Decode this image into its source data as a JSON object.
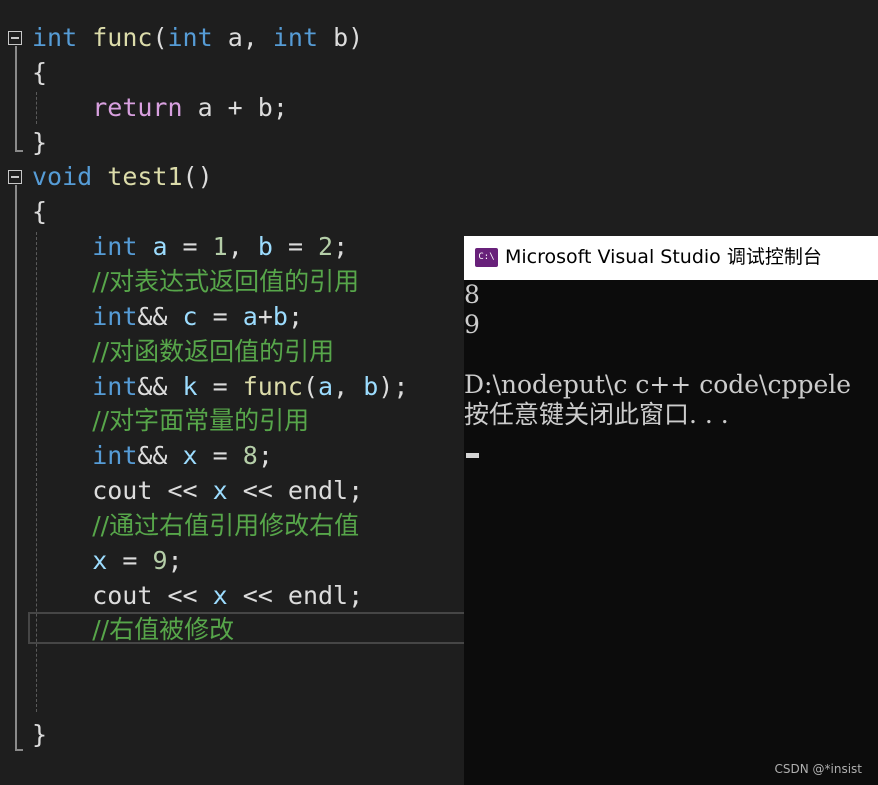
{
  "editor": {
    "lines": [
      [
        {
          "t": "int",
          "c": "kw"
        },
        {
          "t": " "
        },
        {
          "t": "func",
          "c": "fn"
        },
        {
          "t": "("
        },
        {
          "t": "int",
          "c": "kw"
        },
        {
          "t": " a, "
        },
        {
          "t": "int",
          "c": "kw"
        },
        {
          "t": " b)"
        }
      ],
      [
        {
          "t": "{"
        }
      ],
      [
        {
          "t": "    "
        },
        {
          "t": "return",
          "c": "ctrl"
        },
        {
          "t": " a + b;"
        }
      ],
      [
        {
          "t": "}"
        }
      ],
      [
        {
          "t": "void",
          "c": "kw"
        },
        {
          "t": " "
        },
        {
          "t": "test1",
          "c": "fn"
        },
        {
          "t": "()"
        }
      ],
      [
        {
          "t": "{"
        }
      ],
      [
        {
          "t": "    "
        },
        {
          "t": "int",
          "c": "kw"
        },
        {
          "t": " "
        },
        {
          "t": "a",
          "c": "var"
        },
        {
          "t": " = "
        },
        {
          "t": "1",
          "c": "num"
        },
        {
          "t": ", "
        },
        {
          "t": "b",
          "c": "var"
        },
        {
          "t": " = "
        },
        {
          "t": "2",
          "c": "num"
        },
        {
          "t": ";"
        }
      ],
      [
        {
          "t": "    "
        },
        {
          "t": "//对表达式返回值的引用",
          "c": "cm"
        }
      ],
      [
        {
          "t": "    "
        },
        {
          "t": "int",
          "c": "kw"
        },
        {
          "t": "&& "
        },
        {
          "t": "c",
          "c": "var"
        },
        {
          "t": " = "
        },
        {
          "t": "a",
          "c": "var"
        },
        {
          "t": "+"
        },
        {
          "t": "b",
          "c": "var"
        },
        {
          "t": ";"
        }
      ],
      [
        {
          "t": "    "
        },
        {
          "t": "//对函数返回值的引用",
          "c": "cm"
        }
      ],
      [
        {
          "t": "    "
        },
        {
          "t": "int",
          "c": "kw"
        },
        {
          "t": "&& "
        },
        {
          "t": "k",
          "c": "var"
        },
        {
          "t": " = "
        },
        {
          "t": "func",
          "c": "fn"
        },
        {
          "t": "("
        },
        {
          "t": "a",
          "c": "var"
        },
        {
          "t": ", "
        },
        {
          "t": "b",
          "c": "var"
        },
        {
          "t": ");"
        }
      ],
      [
        {
          "t": "    "
        },
        {
          "t": "//对字面常量的引用",
          "c": "cm"
        }
      ],
      [
        {
          "t": "    "
        },
        {
          "t": "int",
          "c": "kw"
        },
        {
          "t": "&& "
        },
        {
          "t": "x",
          "c": "var"
        },
        {
          "t": " = "
        },
        {
          "t": "8",
          "c": "num"
        },
        {
          "t": ";"
        }
      ],
      [
        {
          "t": "    cout << "
        },
        {
          "t": "x",
          "c": "var"
        },
        {
          "t": " << endl;"
        }
      ],
      [
        {
          "t": "    "
        },
        {
          "t": "//通过右值引用修改右值",
          "c": "cm"
        }
      ],
      [
        {
          "t": "    "
        },
        {
          "t": "x",
          "c": "var"
        },
        {
          "t": " = "
        },
        {
          "t": "9",
          "c": "num"
        },
        {
          "t": ";"
        }
      ],
      [
        {
          "t": "    cout << "
        },
        {
          "t": "x",
          "c": "var"
        },
        {
          "t": " << endl;"
        }
      ],
      [
        {
          "t": "    "
        },
        {
          "t": "//右值被修改",
          "c": "cm"
        }
      ],
      [],
      [],
      [
        {
          "t": "}"
        }
      ]
    ]
  },
  "console": {
    "title": "Microsoft Visual Studio 调试控制台",
    "icon": "vs-console-icon",
    "icon_text": "C:\\",
    "output": [
      "8",
      "9",
      "",
      "D:\\nodeput\\c c++ code\\cppele",
      "按任意键关闭此窗口. . ."
    ]
  },
  "watermark": "CSDN @*insist",
  "colors": {
    "background": "#1e1e1e",
    "keyword": "#569cd6",
    "function": "#dcdcaa",
    "variable": "#9cdcfe",
    "number": "#b5cea8",
    "control": "#d8a0df",
    "comment": "#57a64a",
    "console_bg": "#0c0c0c",
    "console_titlebar": "#ffffff",
    "vs_icon": "#68217a"
  }
}
